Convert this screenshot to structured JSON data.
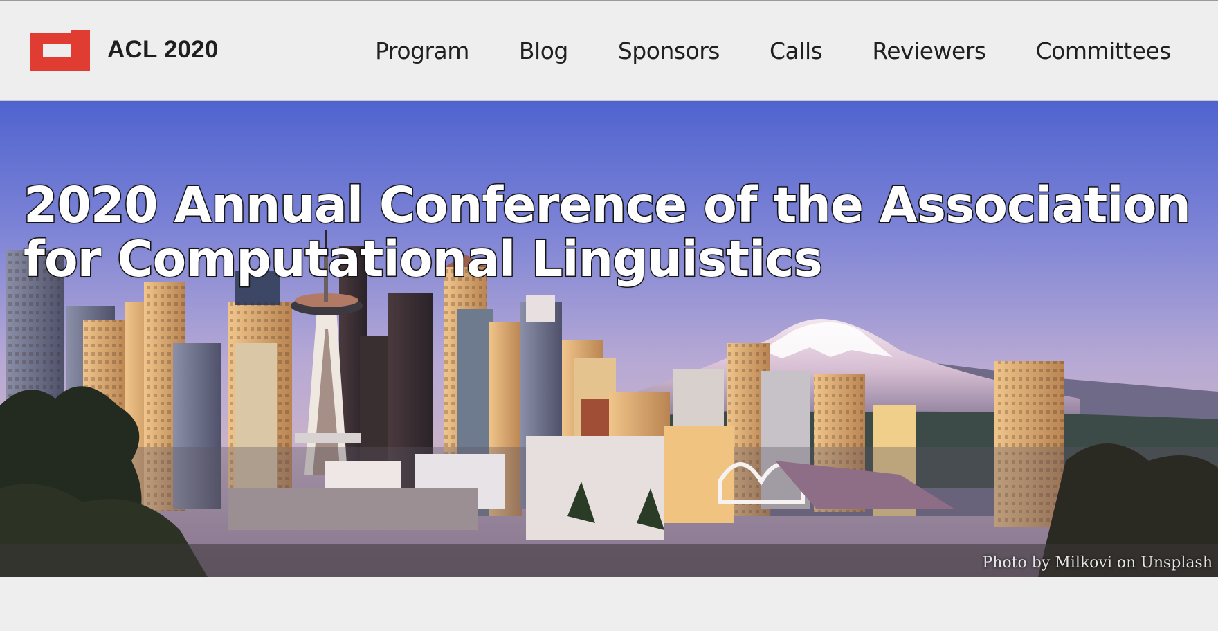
{
  "header": {
    "brand": "ACL 2020",
    "logo_icon": "acl-logo-icon",
    "logo_color": "#e03c31",
    "nav": [
      {
        "label": "Program"
      },
      {
        "label": "Blog"
      },
      {
        "label": "Sponsors"
      },
      {
        "label": "Calls"
      },
      {
        "label": "Reviewers"
      },
      {
        "label": "Committees"
      }
    ]
  },
  "hero": {
    "title": "2020 Annual Conference of the Association for Computational Linguistics",
    "photo_credit": "Photo by Milkovi on Unsplash",
    "image_description_icon": "seattle-skyline-image"
  }
}
